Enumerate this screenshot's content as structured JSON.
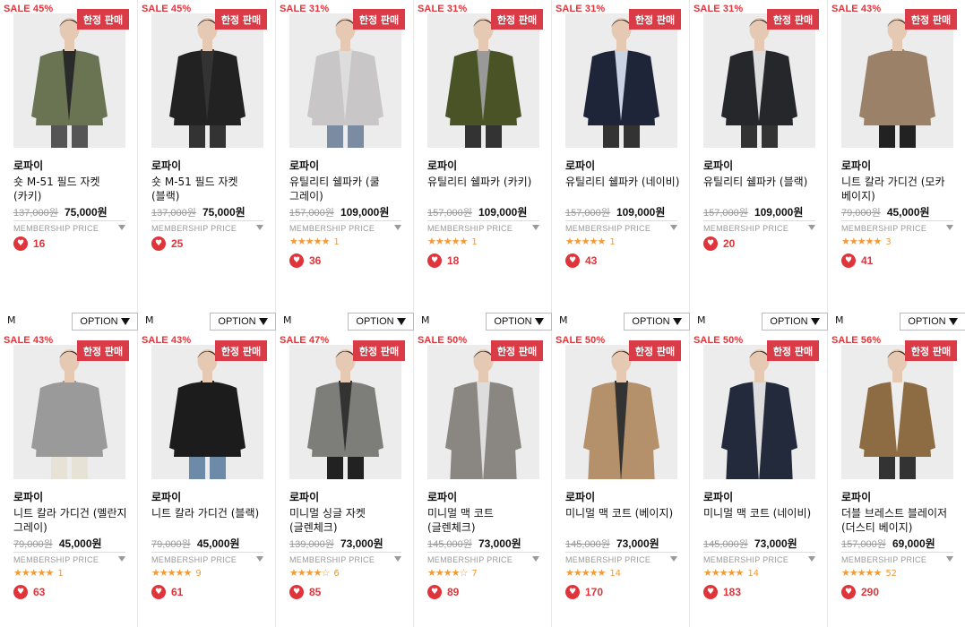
{
  "colors": {
    "sale": "#e0343b",
    "badge": "#d93b47",
    "star": "#f29a38",
    "heart": "#e0343b"
  },
  "member_label": "MEMBERSHIP PRICE",
  "option_label": "OPTION",
  "rows": [
    [
      {
        "sale": "SALE 45%",
        "badge": "한정 판매",
        "brand": "로파이",
        "name": "숏 M-51 필드 자켓 (카키)",
        "orig": "137,000원",
        "price": "75,000원",
        "stars": "",
        "reviews": "",
        "likes": "16",
        "size": "M",
        "garment": "#6b7452",
        "inner": "#2a2a2a",
        "bottom": "#555"
      },
      {
        "sale": "SALE 45%",
        "badge": "한정 판매",
        "brand": "로파이",
        "name": "숏 M-51 필드 자켓 (블랙)",
        "orig": "137,000원",
        "price": "75,000원",
        "stars": "",
        "reviews": "",
        "likes": "25",
        "size": "M",
        "garment": "#222222",
        "inner": "#333",
        "bottom": "#333"
      },
      {
        "sale": "SALE 31%",
        "badge": "한정 판매",
        "brand": "로파이",
        "name": "유틸리티 쉘파카 (쿨 그레이)",
        "orig": "157,000원",
        "price": "109,000원",
        "stars": "★★★★★",
        "reviews": "1",
        "likes": "36",
        "size": "M",
        "garment": "#c8c6c6",
        "inner": "#ddd",
        "bottom": "#7b8ba1"
      },
      {
        "sale": "SALE 31%",
        "badge": "한정 판매",
        "brand": "로파이",
        "name": "유틸리티 쉘파카 (카키)",
        "orig": "157,000원",
        "price": "109,000원",
        "stars": "★★★★★",
        "reviews": "1",
        "likes": "18",
        "size": "M",
        "garment": "#4a5326",
        "inner": "#999",
        "bottom": "#333"
      },
      {
        "sale": "SALE 31%",
        "badge": "한정 판매",
        "brand": "로파이",
        "name": "유틸리티 쉘파카 (네이비)",
        "orig": "157,000원",
        "price": "109,000원",
        "stars": "★★★★★",
        "reviews": "1",
        "likes": "43",
        "size": "M",
        "garment": "#1f2538",
        "inner": "#c9d3e3",
        "bottom": "#333"
      },
      {
        "sale": "SALE 31%",
        "badge": "한정 판매",
        "brand": "로파이",
        "name": "유틸리티 쉘파카 (블랙)",
        "orig": "157,000원",
        "price": "109,000원",
        "stars": "",
        "reviews": "",
        "likes": "20",
        "size": "M",
        "garment": "#25272b",
        "inner": "#ddd",
        "bottom": "#333"
      },
      {
        "sale": "SALE 43%",
        "badge": "한정 판매",
        "brand": "로파이",
        "name": "니트 칼라 가디건 (모카 베이지)",
        "orig": "79,000원",
        "price": "45,000원",
        "stars": "★★★★★",
        "reviews": "3",
        "likes": "41",
        "size": "M",
        "garment": "#9b8167",
        "inner": "#9b8167",
        "bottom": "#222"
      }
    ],
    [
      {
        "sale": "SALE 43%",
        "badge": "한정 판매",
        "brand": "로파이",
        "name": "니트 칼라 가디건 (멜란지 그레이)",
        "orig": "79,000원",
        "price": "45,000원",
        "stars": "★★★★★",
        "reviews": "1",
        "likes": "63",
        "garment": "#9a9a9a",
        "inner": "#9a9a9a",
        "bottom": "#e7e2d6"
      },
      {
        "sale": "SALE 43%",
        "badge": "한정 판매",
        "brand": "로파이",
        "name": "니트 칼라 가디건 (블랙)",
        "orig": "79,000원",
        "price": "45,000원",
        "stars": "★★★★★",
        "reviews": "9",
        "likes": "61",
        "garment": "#1c1c1c",
        "inner": "#1c1c1c",
        "bottom": "#6d8aa8"
      },
      {
        "sale": "SALE 47%",
        "badge": "한정 판매",
        "brand": "로파이",
        "name": "미니멀 싱글 자켓 (글렌체크)",
        "orig": "139,000원",
        "price": "73,000원",
        "stars": "★★★★☆",
        "reviews": "6",
        "likes": "85",
        "garment": "#7d7d7a",
        "inner": "#333",
        "bottom": "#222"
      },
      {
        "sale": "SALE 50%",
        "badge": "한정 판매",
        "brand": "로파이",
        "name": "미니멀 맥 코트 (글렌체크)",
        "orig": "145,000원",
        "price": "73,000원",
        "stars": "★★★★☆",
        "reviews": "7",
        "likes": "89",
        "garment": "#8a8782",
        "inner": "#ddd",
        "bottom": "#333"
      },
      {
        "sale": "SALE 50%",
        "badge": "한정 판매",
        "brand": "로파이",
        "name": "미니멀 맥 코트 (베이지)",
        "orig": "145,000원",
        "price": "73,000원",
        "stars": "★★★★★",
        "reviews": "14",
        "likes": "170",
        "garment": "#b4906b",
        "inner": "#333",
        "bottom": "#333"
      },
      {
        "sale": "SALE 50%",
        "badge": "한정 판매",
        "brand": "로파이",
        "name": "미니멀 맥 코트 (네이비)",
        "orig": "145,000원",
        "price": "73,000원",
        "stars": "★★★★★",
        "reviews": "14",
        "likes": "183",
        "garment": "#232a3c",
        "inner": "#ddd",
        "bottom": "#333"
      },
      {
        "sale": "SALE 56%",
        "badge": "한정 판매",
        "brand": "로파이",
        "name": "더블 브레스트 블레이저 (더스티 베이지)",
        "orig": "157,000원",
        "price": "69,000원",
        "stars": "★★★★★",
        "reviews": "52",
        "likes": "290",
        "garment": "#8d6c43",
        "inner": "#eee",
        "bottom": "#333"
      }
    ]
  ]
}
